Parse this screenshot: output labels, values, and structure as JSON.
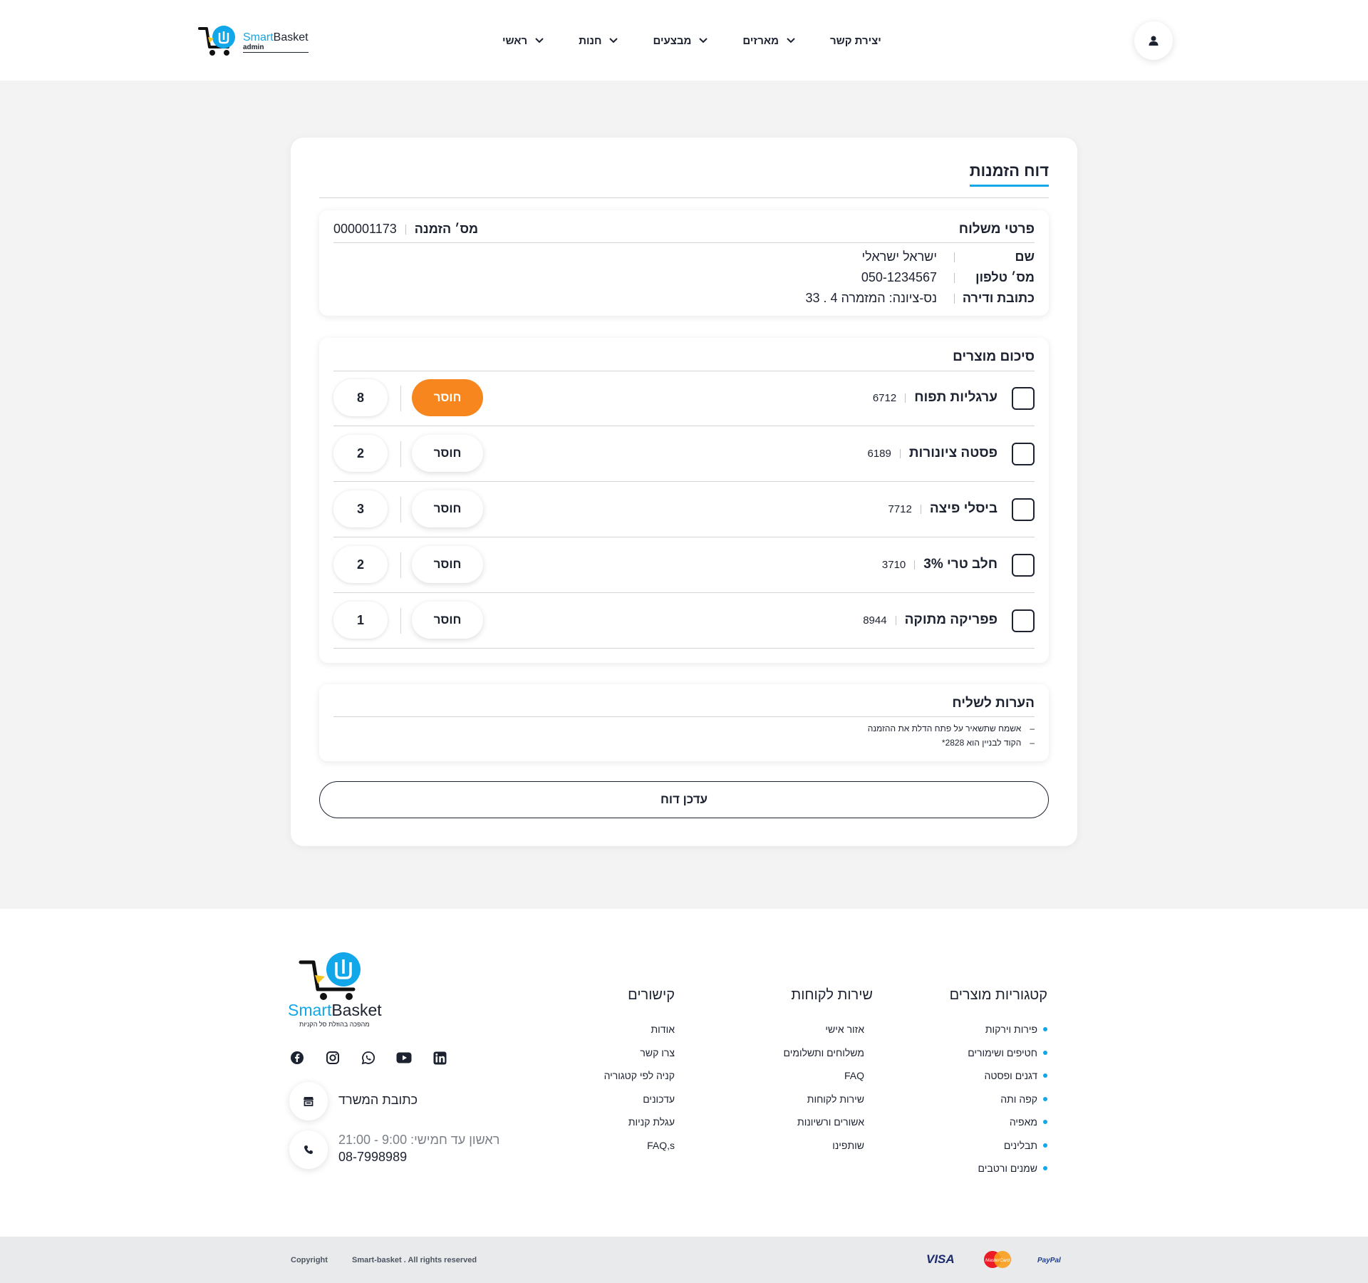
{
  "header": {
    "logo_brand_a": "Smart",
    "logo_brand_b": "Basket",
    "logo_sub": "admin",
    "nav": [
      {
        "label": "ראשי",
        "has_dropdown": true
      },
      {
        "label": "חנות",
        "has_dropdown": true
      },
      {
        "label": "מבצעים",
        "has_dropdown": true
      },
      {
        "label": "מארזים",
        "has_dropdown": true
      },
      {
        "label": "יצירת קשר",
        "has_dropdown": false
      }
    ],
    "user_icon": "user-icon"
  },
  "report": {
    "title": "דוח הזמנות",
    "delivery": {
      "heading": "פרטי משלוח",
      "order_label": "מס׳ הזמנה",
      "order_number": "000001173",
      "rows": [
        {
          "label": "שם",
          "value": "ישראל ישראלי"
        },
        {
          "label": "מס׳ טלפון",
          "value": "050-1234567"
        },
        {
          "label": "כתובת ודירה",
          "value": "נס-ציונה: המזמרה 4 . 33"
        }
      ]
    },
    "products": {
      "heading": "סיכום מוצרים",
      "missing_label": "חוסר",
      "items": [
        {
          "name": "ערגליות תפוח",
          "code": "6712",
          "qty": "8",
          "missing_active": true,
          "checked": false
        },
        {
          "name": "פסטה ציונורות",
          "code": "6189",
          "qty": "2",
          "missing_active": false,
          "checked": false
        },
        {
          "name": "ביסלי פיצה",
          "code": "7712",
          "qty": "3",
          "missing_active": false,
          "checked": false
        },
        {
          "name": "חלב טרי 3%",
          "code": "3710",
          "qty": "2",
          "missing_active": false,
          "checked": false
        },
        {
          "name": "פפריקה מתוקה",
          "code": "8944",
          "qty": "1",
          "missing_active": false,
          "checked": false
        }
      ]
    },
    "notes": {
      "heading": "הערות לשליח",
      "items": [
        "אשמח שתשאיר על פתח הדלת את ההזמנה",
        "הקוד לבניין הוא 2828*"
      ]
    },
    "update_button": "עדכן דוח"
  },
  "footer": {
    "logo_brand_a": "Smart",
    "logo_brand_b": "Basket",
    "tagline": "מהפכה בהוזלת סל הקניות",
    "socials": [
      "facebook-icon",
      "instagram-icon",
      "whatsapp-icon",
      "youtube-icon",
      "linkedin-icon"
    ],
    "office_label": "כתובת המשרד",
    "hours": "ראשון עד חמישי: 9:00 - 21:00",
    "phone": "08-7998989",
    "col_categories": {
      "title": "קטגוריות מוצרים",
      "links": [
        "פירות וירקות",
        "חטיפים ושימורים",
        "דגנים ופסטה",
        "קפה ותה",
        "מאפיה",
        "תבלינים",
        "שמנים ורטבים"
      ]
    },
    "col_service": {
      "title": "שירות לקוחות",
      "links": [
        "אזור אישי",
        "משלוחים ותשלומים",
        "FAQ",
        "שירות לקוחות",
        "אשורים ורשיונות",
        "שותפינו"
      ]
    },
    "col_links": {
      "title": "קישורים",
      "links": [
        "אודות",
        "צרו קשר",
        "קניה לפי קטגוריה",
        "עדכונים",
        "עגלת קניות",
        "FAQ,s"
      ]
    },
    "copyright": "Copyright",
    "rights": "Smart-basket . All rights reserved",
    "payments": [
      "VISA",
      "MasterCard",
      "PayPal"
    ]
  },
  "colors": {
    "accent": "#12a7e8",
    "orange": "#f7861f",
    "dark": "#1c2230",
    "bg": "#f2f3f2"
  }
}
